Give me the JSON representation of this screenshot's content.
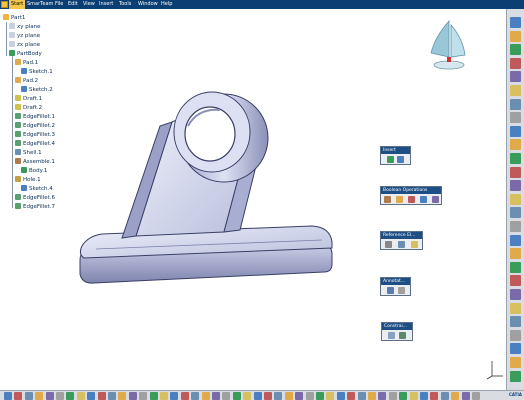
{
  "menubar": {
    "items": [
      "Start",
      "SmarTeam",
      "File",
      "Edit",
      "View",
      "Insert",
      "Tools",
      "Window",
      "Help"
    ]
  },
  "tree": {
    "nodes": [
      {
        "label": "Part1",
        "icon": "part-icon",
        "color": "#f0b43a"
      },
      {
        "label": "xy plane",
        "icon": "plane-icon",
        "color": "#c7d2de"
      },
      {
        "label": "yz plane",
        "icon": "plane-icon",
        "color": "#c7d2de"
      },
      {
        "label": "zx plane",
        "icon": "plane-icon",
        "color": "#c7d2de"
      },
      {
        "label": "PartBody",
        "icon": "body-icon",
        "color": "#3a9c5a"
      },
      {
        "label": "Pad.1",
        "icon": "pad-icon",
        "color": "#e0a94a"
      },
      {
        "label": "Sketch.1",
        "icon": "sketch-icon",
        "color": "#4a7fc0"
      },
      {
        "label": "Pad.2",
        "icon": "pad-icon",
        "color": "#e0a94a"
      },
      {
        "label": "Sketch.2",
        "icon": "sketch-icon",
        "color": "#4a7fc0"
      },
      {
        "label": "Draft.1",
        "icon": "draft-icon",
        "color": "#cfc24a"
      },
      {
        "label": "Draft.2",
        "icon": "draft-icon",
        "color": "#cfc24a"
      },
      {
        "label": "EdgeFillet.1",
        "icon": "fillet-icon",
        "color": "#5aa06a"
      },
      {
        "label": "EdgeFillet.2",
        "icon": "fillet-icon",
        "color": "#5aa06a"
      },
      {
        "label": "EdgeFillet.3",
        "icon": "fillet-icon",
        "color": "#5aa06a"
      },
      {
        "label": "EdgeFillet.4",
        "icon": "fillet-icon",
        "color": "#5aa06a"
      },
      {
        "label": "Shell.1",
        "icon": "shell-icon",
        "color": "#6a8fb0"
      },
      {
        "label": "Assemble.1",
        "icon": "assemble-icon",
        "color": "#b07a4a"
      },
      {
        "label": "Body.1",
        "icon": "body-icon",
        "color": "#3a9c5a"
      },
      {
        "label": "Hole.1",
        "icon": "hole-icon",
        "color": "#c0a040"
      },
      {
        "label": "Sketch.4",
        "icon": "sketch-icon",
        "color": "#4a7fc0"
      },
      {
        "label": "EdgeFillet.6",
        "icon": "fillet-icon",
        "color": "#5aa06a"
      },
      {
        "label": "EdgeFillet.7",
        "icon": "fillet-icon",
        "color": "#5aa06a"
      }
    ]
  },
  "palettes": {
    "insert": {
      "title": "Insert",
      "icons": [
        "body-icon",
        "assemble-icon"
      ]
    },
    "boolean": {
      "title": "Boolean Operations",
      "icons": [
        "assemble-icon",
        "add-icon",
        "remove-icon",
        "intersect-icon",
        "trim-icon"
      ]
    },
    "reference": {
      "title": "Reference El...",
      "icons": [
        "point-icon",
        "line-icon",
        "plane-icon"
      ]
    },
    "annotations": {
      "title": "Annotat...",
      "icons": [
        "text-icon",
        "flag-icon"
      ]
    },
    "constraints": {
      "title": "Constrai...",
      "icons": [
        "constraint-icon",
        "constraint-defined-icon"
      ]
    }
  },
  "colors": {
    "menubar_bg": "#0b3f73",
    "part_face": "#d5d9ec",
    "part_shade": "#8e93b8",
    "part_edge": "#3a3f66",
    "palette_title": "#1e4f84"
  },
  "status": {
    "logo_text": "CATIA"
  }
}
